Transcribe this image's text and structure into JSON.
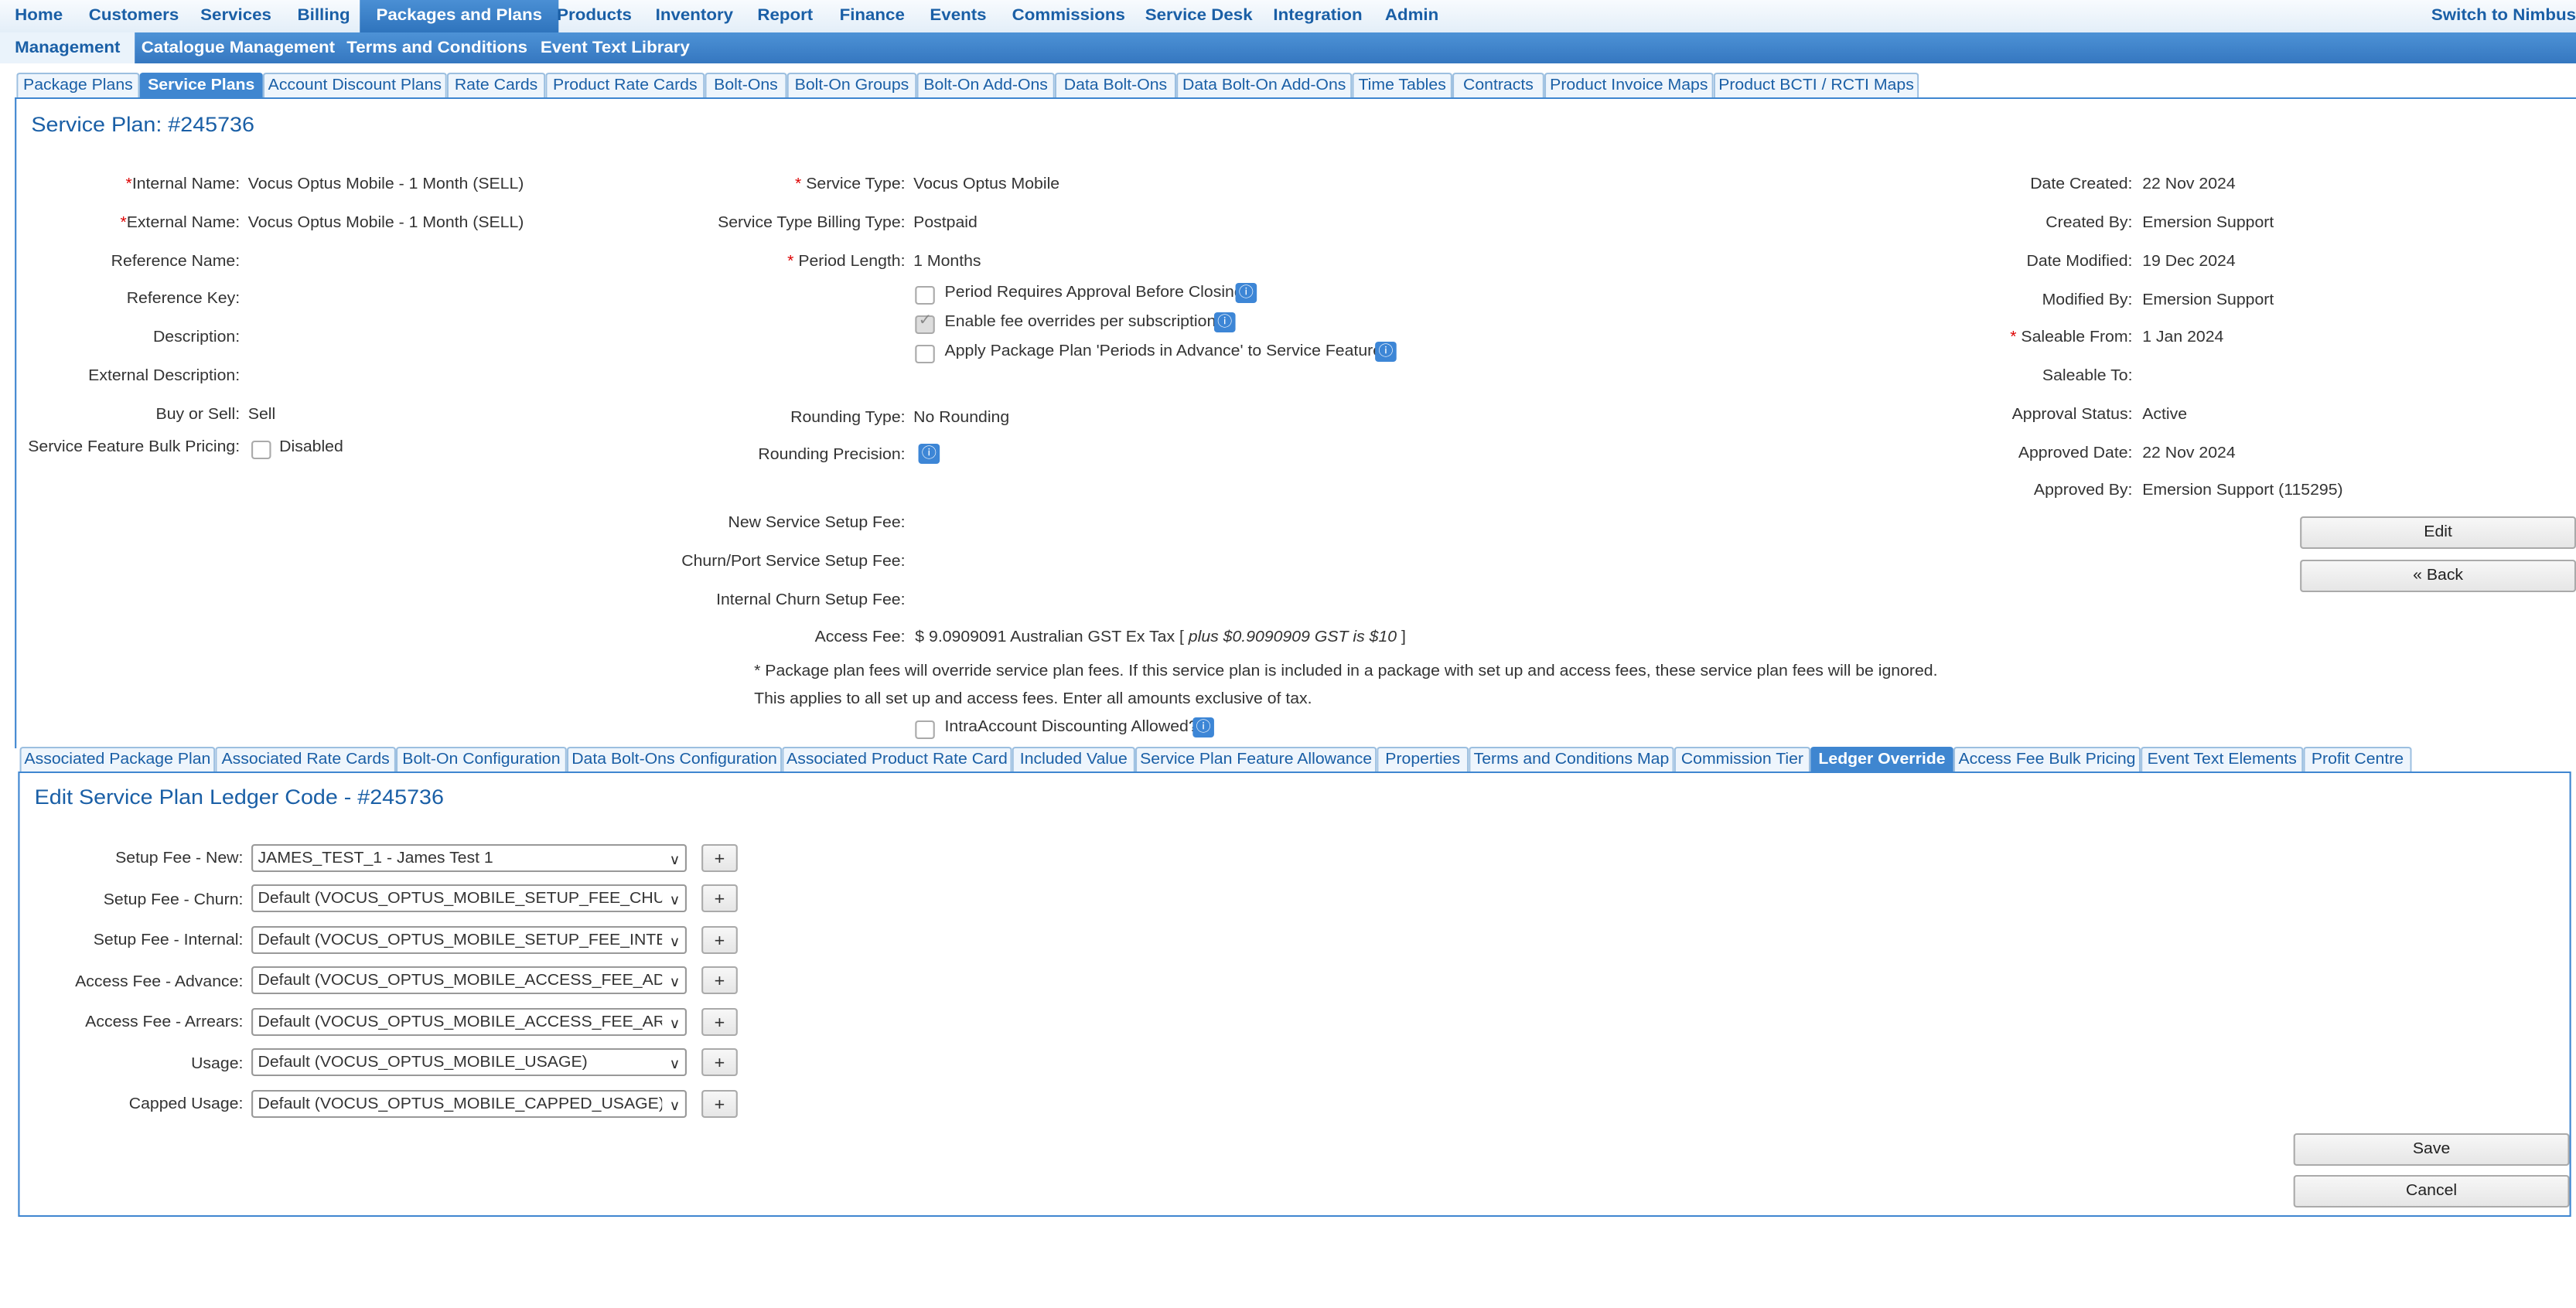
{
  "topnav": {
    "items": [
      "Home",
      "Customers",
      "Services",
      "Billing",
      "Packages and Plans",
      "Products",
      "Inventory",
      "Report",
      "Finance",
      "Events",
      "Commissions",
      "Service Desk",
      "Integration",
      "Admin"
    ],
    "switch": "Switch to Nimbus"
  },
  "subnav": {
    "items": [
      "Management",
      "Catalogue Management",
      "Terms and Conditions",
      "Event Text Library"
    ]
  },
  "tabs_top": [
    "Package Plans",
    "Service Plans",
    "Account Discount Plans",
    "Rate Cards",
    "Product Rate Cards",
    "Bolt-Ons",
    "Bolt-On Groups",
    "Bolt-On Add-Ons",
    "Data Bolt-Ons",
    "Data Bolt-On Add-Ons",
    "Time Tables",
    "Contracts",
    "Product Invoice Maps",
    "Product BCTI / RCTI Maps"
  ],
  "plan": {
    "title": "Service Plan: #245736",
    "left": {
      "internal_name_label": "Internal Name:",
      "internal_name": "Vocus Optus Mobile - 1 Month (SELL)",
      "external_name_label": "External Name:",
      "external_name": "Vocus Optus Mobile - 1 Month (SELL)",
      "reference_name_label": "Reference Name:",
      "reference_key_label": "Reference Key:",
      "description_label": "Description:",
      "external_description_label": "External Description:",
      "buy_sell_label": "Buy or Sell:",
      "buy_sell": "Sell",
      "bulk_pricing_label": "Service Feature Bulk Pricing:",
      "bulk_pricing": "Disabled"
    },
    "middle": {
      "service_type_label": "Service Type:",
      "service_type": "Vocus Optus Mobile",
      "billing_type_label": "Service Type Billing Type:",
      "billing_type": "Postpaid",
      "period_length_label": "Period Length:",
      "period_length": "1 Months",
      "chk1": "Period Requires Approval Before Closing",
      "chk2": "Enable fee overrides per subscription.",
      "chk3": "Apply Package Plan 'Periods in Advance' to Service Features",
      "rounding_type_label": "Rounding Type:",
      "rounding_type": "No Rounding",
      "rounding_precision_label": "Rounding Precision:",
      "new_setup_label": "New Service Setup Fee:",
      "churn_setup_label": "Churn/Port Service Setup Fee:",
      "internal_churn_label": "Internal Churn Setup Fee:",
      "access_fee_label": "Access Fee:",
      "access_fee_a": "$  9.0909091  Australian GST  Ex Tax [",
      "access_fee_b": "plus $0.9090909 GST is $10",
      "access_fee_c": "]",
      "note1": "* Package plan fees will override service plan fees. If this service plan is included in a package with set up and access fees, these service plan fees will be ignored.",
      "note2": "This applies to all set up and access fees. Enter all amounts exclusive of tax.",
      "intra_label": "IntraAccount Discounting Allowed?"
    },
    "right": {
      "date_created_label": "Date Created:",
      "date_created": "22 Nov 2024",
      "created_by_label": "Created By:",
      "created_by": "Emersion Support",
      "date_modified_label": "Date Modified:",
      "date_modified": "19 Dec 2024",
      "modified_by_label": "Modified By:",
      "modified_by": "Emersion Support",
      "saleable_from_label": "Saleable From:",
      "saleable_from": "1 Jan 2024",
      "saleable_to_label": "Saleable To:",
      "approval_status_label": "Approval Status:",
      "approval_status": "Active",
      "approved_date_label": "Approved Date:",
      "approved_date": "22 Nov 2024",
      "approved_by_label": "Approved By:",
      "approved_by": "Emersion Support (115295)",
      "edit": "Edit",
      "back": "« Back"
    }
  },
  "tabs_bottom": [
    "Associated Package Plan",
    "Associated Rate Cards",
    "Bolt-On Configuration",
    "Data Bolt-Ons Configuration",
    "Associated Product Rate Card",
    "Included Value",
    "Service Plan Feature Allowance",
    "Properties",
    "Terms and Conditions Map",
    "Commission Tier",
    "Ledger Override",
    "Access Fee Bulk Pricing",
    "Event Text Elements",
    "Profit Centre"
  ],
  "ledger": {
    "title": "Edit Service Plan Ledger Code - #245736",
    "rows": [
      {
        "label": "Setup Fee - New:",
        "value": "JAMES_TEST_1 - James Test 1"
      },
      {
        "label": "Setup Fee - Churn:",
        "value": "Default (VOCUS_OPTUS_MOBILE_SETUP_FEE_CHURN)"
      },
      {
        "label": "Setup Fee - Internal:",
        "value": "Default (VOCUS_OPTUS_MOBILE_SETUP_FEE_INTERNAL)"
      },
      {
        "label": "Access Fee - Advance:",
        "value": "Default (VOCUS_OPTUS_MOBILE_ACCESS_FEE_ADVANCE)"
      },
      {
        "label": "Access Fee - Arrears:",
        "value": "Default (VOCUS_OPTUS_MOBILE_ACCESS_FEE_ARREARS)"
      },
      {
        "label": "Usage:",
        "value": "Default (VOCUS_OPTUS_MOBILE_USAGE)"
      },
      {
        "label": "Capped Usage:",
        "value": "Default (VOCUS_OPTUS_MOBILE_CAPPED_USAGE)"
      }
    ],
    "plus": "+",
    "save": "Save",
    "cancel": "Cancel"
  }
}
